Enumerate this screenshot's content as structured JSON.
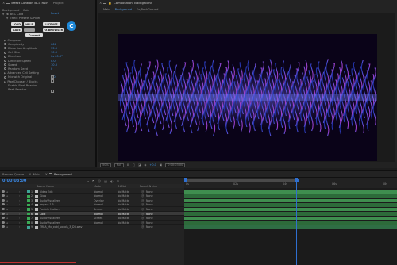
{
  "colors": {
    "accent": "#3d8fe0",
    "panel": "#232323",
    "timecode": "#3b89e6",
    "layer_label_green": "#3aaa55",
    "layer_label_teal": "#3fa596",
    "bar_dark": "#2d6b3a",
    "bar_light": "#3f8e4f",
    "playhead": "#2f6fd0"
  },
  "left_panel": {
    "tabs": [
      {
        "label": "Effect Controls BCC Ruin"
      },
      {
        "label": "Project"
      }
    ],
    "layer_path": "Background • Cold",
    "effect_name": "BCC Cold",
    "reset_label": "Reset",
    "presets_label": "Effect Presets & Pixel",
    "buttons": {
      "load": "LOAD",
      "save": "SAVE",
      "help": "HELP",
      "license": "LICENSE",
      "fx_browser": "FX BROWSER",
      "current": "Current"
    },
    "properties": [
      {
        "label": "Compose",
        "value": ""
      },
      {
        "label": "Complexity",
        "value": "666"
      },
      {
        "label": "Distortion Amplitude",
        "value": "33.0"
      },
      {
        "label": "Cell Size",
        "value": "10.0"
      },
      {
        "label": "Direction",
        "value": "0x+0.0°"
      },
      {
        "label": "Direction Speed",
        "value": "0.0"
      },
      {
        "label": "Speed",
        "value": "10.0"
      },
      {
        "label": "Random Seed",
        "value": "0"
      },
      {
        "label": "Advanced Cell Setting",
        "value": ""
      },
      {
        "label": "Mix with Original",
        "value": "0.0"
      },
      {
        "label": "PixelChooser / Blocks",
        "value": ""
      },
      {
        "label": "Enable Beat Reactor",
        "value": ""
      },
      {
        "label": "Beat Reactor",
        "value": ""
      }
    ]
  },
  "comp": {
    "tab_label": "Composition: Background",
    "subtabs": [
      "Main",
      "Background",
      "Fx/BackGround"
    ],
    "zoom": "50%",
    "resolution": "Full",
    "exposure": "+0.0",
    "timecode_small": "0:00:03:00"
  },
  "timeline": {
    "tabs": [
      {
        "label": "Render Queue"
      },
      {
        "label": "Main"
      },
      {
        "label": "Background"
      }
    ],
    "timecode": "0:00:03:00",
    "columns": {
      "source": "Source Name",
      "mode": "Mode",
      "trkmat": "TrkMat",
      "parent": "Parent & Link"
    },
    "ruler_ticks": [
      "0s",
      "02s",
      "04s",
      "06s",
      "08s",
      "10s"
    ],
    "layers": [
      {
        "num": "1",
        "name": "Video Edit",
        "mode": "Normal",
        "trk": "No Matte",
        "parent": "None"
      },
      {
        "num": "2",
        "name": "Glow",
        "mode": "Normal",
        "trk": "No Matte",
        "parent": "None"
      },
      {
        "num": "3",
        "name": "AudioVisualizer",
        "mode": "Overlay",
        "trk": "No Matte",
        "parent": "None"
      },
      {
        "num": "4",
        "name": "Impact 1.5",
        "mode": "Normal",
        "trk": "No Matte",
        "parent": "None"
      },
      {
        "num": "5",
        "name": "Particle Motion",
        "mode": "Screen",
        "trk": "No Matte",
        "parent": "None"
      },
      {
        "num": "6",
        "name": "Cold",
        "mode": "Normal",
        "trk": "No Matte",
        "parent": "None"
      },
      {
        "num": "7",
        "name": "AudioVisualizer",
        "mode": "Screen",
        "trk": "No Matte",
        "parent": "None"
      },
      {
        "num": "8",
        "name": "AudioVisualizer",
        "mode": "Normal",
        "trk": "No Matte",
        "parent": "None"
      },
      {
        "num": "9",
        "name": "TREA_Mx_cold_vocals_3_DR.wav",
        "mode": "",
        "trk": "",
        "parent": "None"
      }
    ]
  }
}
